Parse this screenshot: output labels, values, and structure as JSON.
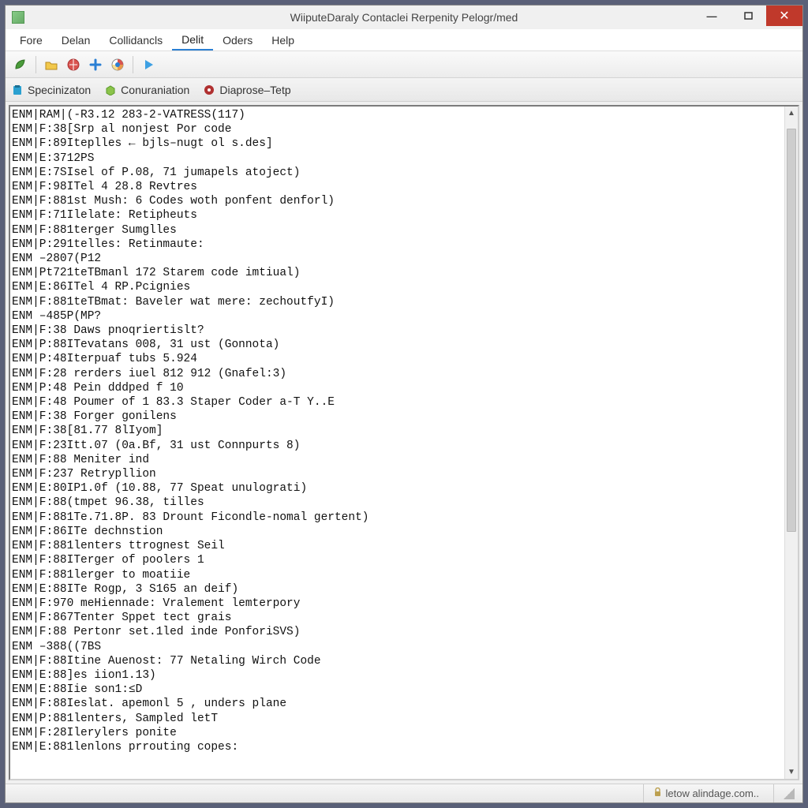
{
  "window": {
    "title": "WiiputeDaraly Contaclei Rerpenity Pelogr/med"
  },
  "menu": {
    "items": [
      "Fore",
      "Delan",
      "Collidancls",
      "Delit",
      "Oders",
      "Help"
    ],
    "active_index": 3
  },
  "toolbar": {
    "icons": [
      "leaf-icon",
      "folder-icon",
      "globe-red-icon",
      "plus-icon",
      "globe-color-icon",
      "play-icon"
    ]
  },
  "tabs": [
    {
      "icon": "clipboard-icon",
      "label": "Specinizaton",
      "color": "#2aa0d0"
    },
    {
      "icon": "box-icon",
      "label": "Conuraniation",
      "color": "#5a9a2a"
    },
    {
      "icon": "disc-icon",
      "label": "Diaprose–Tetp",
      "color": "#b03030"
    }
  ],
  "console_lines": [
    "ENM|RAM|(-R3.12 283-2-VATRESS(117)",
    "ENM|F:38[Srp al nonjest Por code",
    "ENM|F:89Iteplles ← bjls–nugt ol s.des]",
    "ENM|E:3712PS",
    "ENM|E:7SIsel of P.08, 71 jumapels atoject)",
    "ENM|F:98ITel 4 28.8 Revtres",
    "ENM|F:881st Mush: 6 Codes woth ponfent denforl)",
    "ENM|F:71Ilelate: Retipheuts",
    "ENM|F:881terger Sumglles",
    "ENM|P:291telles: Retinmaute:",
    "ENM –2807(P12",
    "ENM|Pt721teTBmanl 172 Starem code imtiual)",
    "ENM|E:86ITel 4 RP.Pcignies",
    "ENM|F:881teTBmat: Baveler wat mere: zechoutfyI)",
    "ENM –485P(MP?",
    "ENM|F:38 Daws pnoqriertislt?",
    "ENM|P:88ITevatans 008, 31 ust (Gonnota)",
    "ENM|P:48Iterpuaf tubs 5.924",
    "ENM|F:28 rerders iuel 812 912 (Gnafel:3)",
    "ENM|P:48 Pein dddped f 10",
    "ENM|F:48 Poumer of 1 83.3 Staper Coder a-T Y..E",
    "ENM|F:38 Forger gonilens",
    "ENM|F:38[81.77 8lIyom]",
    "ENM|F:23Itt.07 (0a.Bf, 31 ust Connpurts 8)",
    "ENM|F:88 Meniter ind",
    "ENM|F:237 Retrypllion",
    "ENM|E:80IP1.0f (10.88, 77 Speat unulograti)",
    "ENM|F:88(tmpet 96.38, tilles",
    "ENM|F:881Te.71.8P. 83 Drount Ficondle-nomal gertent)",
    "ENM|F:86ITe dechnstion",
    "ENM|F:881lenters ttrognest Seil",
    "ENM|F:88ITerger of poolers 1",
    "ENM|F:881lerger to moatiie",
    "ENM|E:88ITe Rogp, 3 S165 an deif)",
    "ENM|F:970 meHiennade: Vralement lemterpory",
    "ENM|F:867Tenter Sppet tect grais",
    "ENM|F:88 Pertonr set.1led inde PonforiSVS)",
    "ENM –388((7BS",
    "ENM|F:88Itine Auenost: 77 Netaling Wirch Code",
    "ENM|E:88]es iion1.13)",
    "ENM|E:88Iie son1:≤D",
    "ENM|F:88Ieslat. apemonl 5 , unders plane",
    "ENM|P:881lenters, Sampled letT",
    "ENM|F:28Ilerylers ponite",
    "ENM|E:881lenlons prrouting copes:"
  ],
  "status": {
    "text": "letow alindage.com.."
  }
}
